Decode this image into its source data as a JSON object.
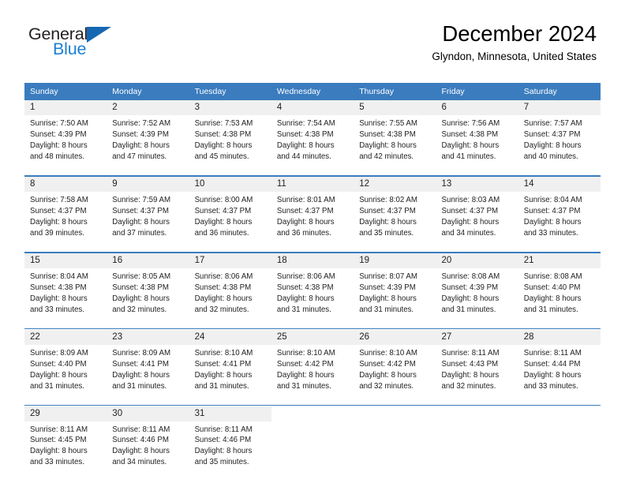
{
  "logo": {
    "word_one": "General",
    "word_two": "Blue",
    "triangle_icon": "blue-triangle-icon",
    "brand_color": "#1b7fd4",
    "triangle_color": "#1567b2"
  },
  "header": {
    "title": "December 2024",
    "subtitle": "Glyndon, Minnesota, United States"
  },
  "calendar": {
    "header_bg": "#3a7cbe",
    "daynum_bg": "#f0f0f0",
    "weekday_headers": [
      "Sunday",
      "Monday",
      "Tuesday",
      "Wednesday",
      "Thursday",
      "Friday",
      "Saturday"
    ],
    "weeks": [
      [
        {
          "day": "1",
          "sunrise": "Sunrise: 7:50 AM",
          "sunset": "Sunset: 4:39 PM",
          "daylight_1": "Daylight: 8 hours",
          "daylight_2": "and 48 minutes."
        },
        {
          "day": "2",
          "sunrise": "Sunrise: 7:52 AM",
          "sunset": "Sunset: 4:39 PM",
          "daylight_1": "Daylight: 8 hours",
          "daylight_2": "and 47 minutes."
        },
        {
          "day": "3",
          "sunrise": "Sunrise: 7:53 AM",
          "sunset": "Sunset: 4:38 PM",
          "daylight_1": "Daylight: 8 hours",
          "daylight_2": "and 45 minutes."
        },
        {
          "day": "4",
          "sunrise": "Sunrise: 7:54 AM",
          "sunset": "Sunset: 4:38 PM",
          "daylight_1": "Daylight: 8 hours",
          "daylight_2": "and 44 minutes."
        },
        {
          "day": "5",
          "sunrise": "Sunrise: 7:55 AM",
          "sunset": "Sunset: 4:38 PM",
          "daylight_1": "Daylight: 8 hours",
          "daylight_2": "and 42 minutes."
        },
        {
          "day": "6",
          "sunrise": "Sunrise: 7:56 AM",
          "sunset": "Sunset: 4:38 PM",
          "daylight_1": "Daylight: 8 hours",
          "daylight_2": "and 41 minutes."
        },
        {
          "day": "7",
          "sunrise": "Sunrise: 7:57 AM",
          "sunset": "Sunset: 4:37 PM",
          "daylight_1": "Daylight: 8 hours",
          "daylight_2": "and 40 minutes."
        }
      ],
      [
        {
          "day": "8",
          "sunrise": "Sunrise: 7:58 AM",
          "sunset": "Sunset: 4:37 PM",
          "daylight_1": "Daylight: 8 hours",
          "daylight_2": "and 39 minutes."
        },
        {
          "day": "9",
          "sunrise": "Sunrise: 7:59 AM",
          "sunset": "Sunset: 4:37 PM",
          "daylight_1": "Daylight: 8 hours",
          "daylight_2": "and 37 minutes."
        },
        {
          "day": "10",
          "sunrise": "Sunrise: 8:00 AM",
          "sunset": "Sunset: 4:37 PM",
          "daylight_1": "Daylight: 8 hours",
          "daylight_2": "and 36 minutes."
        },
        {
          "day": "11",
          "sunrise": "Sunrise: 8:01 AM",
          "sunset": "Sunset: 4:37 PM",
          "daylight_1": "Daylight: 8 hours",
          "daylight_2": "and 36 minutes."
        },
        {
          "day": "12",
          "sunrise": "Sunrise: 8:02 AM",
          "sunset": "Sunset: 4:37 PM",
          "daylight_1": "Daylight: 8 hours",
          "daylight_2": "and 35 minutes."
        },
        {
          "day": "13",
          "sunrise": "Sunrise: 8:03 AM",
          "sunset": "Sunset: 4:37 PM",
          "daylight_1": "Daylight: 8 hours",
          "daylight_2": "and 34 minutes."
        },
        {
          "day": "14",
          "sunrise": "Sunrise: 8:04 AM",
          "sunset": "Sunset: 4:37 PM",
          "daylight_1": "Daylight: 8 hours",
          "daylight_2": "and 33 minutes."
        }
      ],
      [
        {
          "day": "15",
          "sunrise": "Sunrise: 8:04 AM",
          "sunset": "Sunset: 4:38 PM",
          "daylight_1": "Daylight: 8 hours",
          "daylight_2": "and 33 minutes."
        },
        {
          "day": "16",
          "sunrise": "Sunrise: 8:05 AM",
          "sunset": "Sunset: 4:38 PM",
          "daylight_1": "Daylight: 8 hours",
          "daylight_2": "and 32 minutes."
        },
        {
          "day": "17",
          "sunrise": "Sunrise: 8:06 AM",
          "sunset": "Sunset: 4:38 PM",
          "daylight_1": "Daylight: 8 hours",
          "daylight_2": "and 32 minutes."
        },
        {
          "day": "18",
          "sunrise": "Sunrise: 8:06 AM",
          "sunset": "Sunset: 4:38 PM",
          "daylight_1": "Daylight: 8 hours",
          "daylight_2": "and 31 minutes."
        },
        {
          "day": "19",
          "sunrise": "Sunrise: 8:07 AM",
          "sunset": "Sunset: 4:39 PM",
          "daylight_1": "Daylight: 8 hours",
          "daylight_2": "and 31 minutes."
        },
        {
          "day": "20",
          "sunrise": "Sunrise: 8:08 AM",
          "sunset": "Sunset: 4:39 PM",
          "daylight_1": "Daylight: 8 hours",
          "daylight_2": "and 31 minutes."
        },
        {
          "day": "21",
          "sunrise": "Sunrise: 8:08 AM",
          "sunset": "Sunset: 4:40 PM",
          "daylight_1": "Daylight: 8 hours",
          "daylight_2": "and 31 minutes."
        }
      ],
      [
        {
          "day": "22",
          "sunrise": "Sunrise: 8:09 AM",
          "sunset": "Sunset: 4:40 PM",
          "daylight_1": "Daylight: 8 hours",
          "daylight_2": "and 31 minutes."
        },
        {
          "day": "23",
          "sunrise": "Sunrise: 8:09 AM",
          "sunset": "Sunset: 4:41 PM",
          "daylight_1": "Daylight: 8 hours",
          "daylight_2": "and 31 minutes."
        },
        {
          "day": "24",
          "sunrise": "Sunrise: 8:10 AM",
          "sunset": "Sunset: 4:41 PM",
          "daylight_1": "Daylight: 8 hours",
          "daylight_2": "and 31 minutes."
        },
        {
          "day": "25",
          "sunrise": "Sunrise: 8:10 AM",
          "sunset": "Sunset: 4:42 PM",
          "daylight_1": "Daylight: 8 hours",
          "daylight_2": "and 31 minutes."
        },
        {
          "day": "26",
          "sunrise": "Sunrise: 8:10 AM",
          "sunset": "Sunset: 4:42 PM",
          "daylight_1": "Daylight: 8 hours",
          "daylight_2": "and 32 minutes."
        },
        {
          "day": "27",
          "sunrise": "Sunrise: 8:11 AM",
          "sunset": "Sunset: 4:43 PM",
          "daylight_1": "Daylight: 8 hours",
          "daylight_2": "and 32 minutes."
        },
        {
          "day": "28",
          "sunrise": "Sunrise: 8:11 AM",
          "sunset": "Sunset: 4:44 PM",
          "daylight_1": "Daylight: 8 hours",
          "daylight_2": "and 33 minutes."
        }
      ],
      [
        {
          "day": "29",
          "sunrise": "Sunrise: 8:11 AM",
          "sunset": "Sunset: 4:45 PM",
          "daylight_1": "Daylight: 8 hours",
          "daylight_2": "and 33 minutes."
        },
        {
          "day": "30",
          "sunrise": "Sunrise: 8:11 AM",
          "sunset": "Sunset: 4:46 PM",
          "daylight_1": "Daylight: 8 hours",
          "daylight_2": "and 34 minutes."
        },
        {
          "day": "31",
          "sunrise": "Sunrise: 8:11 AM",
          "sunset": "Sunset: 4:46 PM",
          "daylight_1": "Daylight: 8 hours",
          "daylight_2": "and 35 minutes."
        },
        {
          "day": "",
          "sunrise": "",
          "sunset": "",
          "daylight_1": "",
          "daylight_2": ""
        },
        {
          "day": "",
          "sunrise": "",
          "sunset": "",
          "daylight_1": "",
          "daylight_2": ""
        },
        {
          "day": "",
          "sunrise": "",
          "sunset": "",
          "daylight_1": "",
          "daylight_2": ""
        },
        {
          "day": "",
          "sunrise": "",
          "sunset": "",
          "daylight_1": "",
          "daylight_2": ""
        }
      ]
    ]
  }
}
